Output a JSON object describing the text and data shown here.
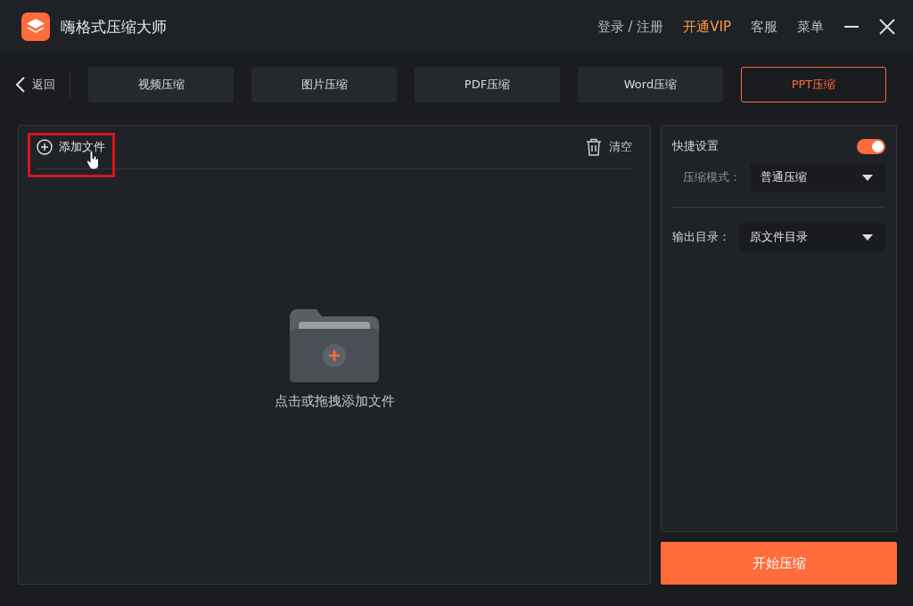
{
  "app": {
    "title": "嗨格式压缩大师"
  },
  "header_links": [
    {
      "label": "登录 / 注册",
      "kind": "normal"
    },
    {
      "label": "开通VIP",
      "kind": "vip"
    },
    {
      "label": "客服",
      "kind": "normal"
    },
    {
      "label": "菜单",
      "kind": "normal"
    }
  ],
  "back": {
    "label": "返回"
  },
  "tabs": [
    {
      "label": "视频压缩",
      "selected": false
    },
    {
      "label": "图片压缩",
      "selected": false
    },
    {
      "label": "PDF压缩",
      "selected": false
    },
    {
      "label": "Word压缩",
      "selected": false
    },
    {
      "label": "PPT压缩",
      "selected": true
    }
  ],
  "file_panel": {
    "add_label": "添加文件",
    "add_highlighted": true,
    "clear_label": "清空",
    "drop_hint": "点击或拖拽添加文件"
  },
  "settings": {
    "title": "快捷设置",
    "quick_on": true,
    "fields": [
      {
        "kind": "sub",
        "label": "压缩模式：",
        "value": "普通压缩"
      },
      {
        "kind": "main",
        "label": "输出目录：",
        "value": "原文件目录"
      }
    ]
  },
  "start_button": "开始压缩"
}
